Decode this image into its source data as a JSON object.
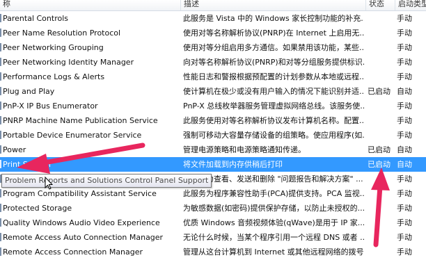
{
  "columns": {
    "name": "称",
    "description": "描述",
    "status": "状态",
    "startup": "启动类型"
  },
  "rows": [
    {
      "name": "Parental Controls",
      "description": "此服务是 Vista 中的 Windows 家长控制功能的补充...",
      "status": "",
      "startup": "手动"
    },
    {
      "name": "Peer Name Resolution Protocol",
      "description": "使用对等名称解析协议(PNRP)在 Internet 上启用无...",
      "status": "",
      "startup": "手动"
    },
    {
      "name": "Peer Networking Grouping",
      "description": "使用对等分组启用多方通信。如果禁用该功能，某些...",
      "status": "",
      "startup": "手动"
    },
    {
      "name": "Peer Networking Identity Manager",
      "description": "向对等名称解析协议(PNRP)和对等分组服务提供标识...",
      "status": "",
      "startup": "手动"
    },
    {
      "name": "Performance Logs & Alerts",
      "description": "性能日志和警报根据预配置的计划参数从本地或远程...",
      "status": "",
      "startup": "手动"
    },
    {
      "name": "Plug and Play",
      "description": "使计算机在极少或没有用户输入的情况下能识别并适...",
      "status": "已启动",
      "startup": "自动"
    },
    {
      "name": "PnP-X IP Bus Enumerator",
      "description": "PnP-X 总线枚举器服务管理虚拟网络总线。该服务使...",
      "status": "",
      "startup": "手动"
    },
    {
      "name": "PNRP Machine Name Publication Service",
      "description": "此服务使用对等名称解析协议发布计算机名称。配置...",
      "status": "",
      "startup": "手动"
    },
    {
      "name": "Portable Device Enumerator Service",
      "description": "强制可移动大容量存储设备的组策略。使应用程序(如...",
      "status": "",
      "startup": "手动"
    },
    {
      "name": "Power",
      "description": "管理电源策略和电源策略通知传递。",
      "status": "已启动",
      "startup": "自动"
    },
    {
      "name": "Print Spooler",
      "description": "将文件加载到内存供稍后打印",
      "status": "已启动",
      "startup": "自动",
      "selected": true
    },
    {
      "name": "Problem Reports and Solutions Control Panel Support",
      "description": "此服务为查看、发送和删除 \"问题报告和解决方案\" ...",
      "status": "",
      "startup": "手动"
    },
    {
      "name": "Program Compatibility Assistant Service",
      "description": "此服务为程序兼容性助手(PCA)提供支持。PCA 监视...",
      "status": "",
      "startup": "手动"
    },
    {
      "name": "Protected Storage",
      "description": "为敏感数据(如密码)提供保护存储，以防止未授权的...",
      "status": "",
      "startup": "手动"
    },
    {
      "name": "Quality Windows Audio Video Experience",
      "description": "优质 Windows 音频视频体验(qWave)是用于 IP 家...",
      "status": "",
      "startup": "手动"
    },
    {
      "name": "Remote Access Auto Connection Manager",
      "description": "无论什么时候，当某个程序引用一个远程 DNS 或者 ...",
      "status": "",
      "startup": "手动"
    },
    {
      "name": "Remote Access Connection Manager",
      "description": "管理从这台计算机到 Internet 或其他远程网络的拨号...",
      "status": "",
      "startup": "手动"
    }
  ],
  "tooltip": "Problem Reports and Solutions Control Panel Support",
  "colors": {
    "selection": "#3399ff",
    "annotation_arrow": "#e8265e"
  }
}
